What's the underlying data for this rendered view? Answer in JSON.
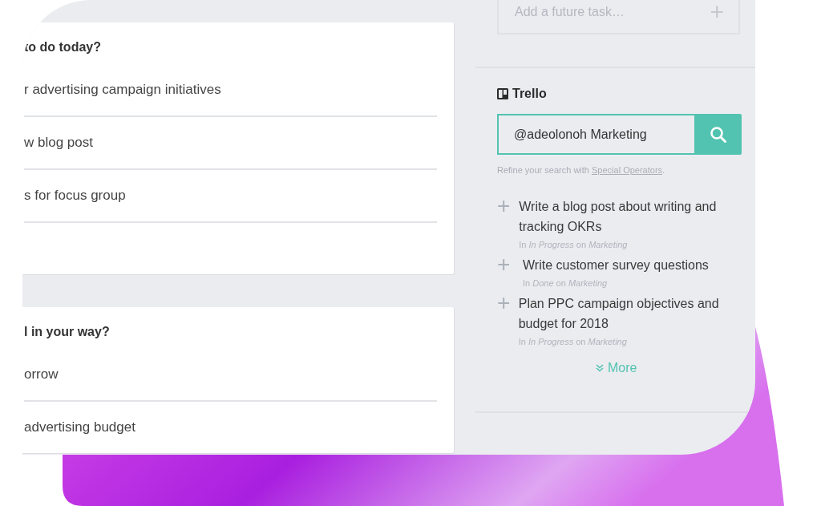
{
  "cards": [
    {
      "heading": "to do today?",
      "rows": [
        "r advertising campaign initiatives",
        "w blog post",
        "s for focus group",
        null
      ]
    },
    {
      "heading": "l in your way?",
      "rows": [
        "orrow",
        "advertising budget"
      ]
    }
  ],
  "future_task": {
    "placeholder": "Add a future task…",
    "add_icon": "+"
  },
  "trello": {
    "title": "Trello",
    "search": {
      "value": "@adeolonoh Marketing"
    },
    "hint": {
      "text": "Refine your search with ",
      "link": "Special Operators",
      "end": "."
    },
    "results": [
      {
        "title": "Write a blog post about writing and tracking OKRs",
        "meta": "In *In Progress* on *Marketing*"
      },
      {
        "title": "Write customer survey questions",
        "meta": "In *Done* on *Marketing*"
      },
      {
        "title": "Plan PPC campaign objectives and budget for 2018",
        "meta": "In *In Progress* on *Marketing*"
      }
    ],
    "more": "More"
  }
}
